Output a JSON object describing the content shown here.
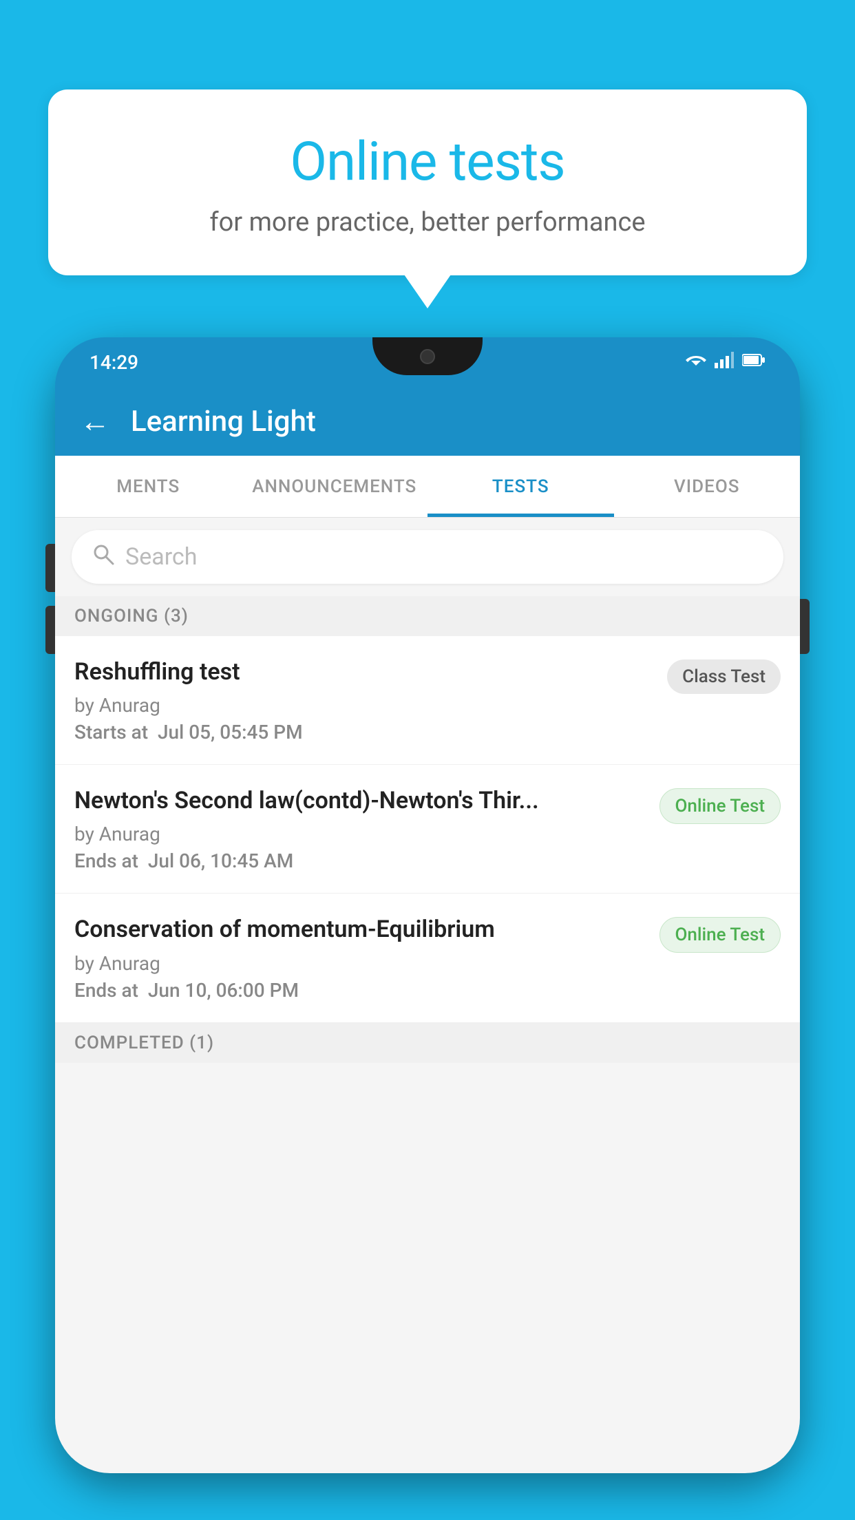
{
  "background_color": "#1ab8e8",
  "speech_bubble": {
    "title": "Online tests",
    "subtitle": "for more practice, better performance"
  },
  "phone": {
    "status_bar": {
      "time": "14:29",
      "icons": [
        "wifi",
        "signal",
        "battery"
      ]
    },
    "header": {
      "title": "Learning Light",
      "back_label": "←"
    },
    "tabs": [
      {
        "label": "MENTS",
        "active": false
      },
      {
        "label": "ANNOUNCEMENTS",
        "active": false
      },
      {
        "label": "TESTS",
        "active": true
      },
      {
        "label": "VIDEOS",
        "active": false
      }
    ],
    "search": {
      "placeholder": "Search"
    },
    "section_ongoing": {
      "label": "ONGOING (3)"
    },
    "tests": [
      {
        "name": "Reshuffling test",
        "author": "by Anurag",
        "time_label": "Starts at",
        "time_value": "Jul 05, 05:45 PM",
        "badge": "Class Test",
        "badge_type": "class"
      },
      {
        "name": "Newton's Second law(contd)-Newton's Thir...",
        "author": "by Anurag",
        "time_label": "Ends at",
        "time_value": "Jul 06, 10:45 AM",
        "badge": "Online Test",
        "badge_type": "online"
      },
      {
        "name": "Conservation of momentum-Equilibrium",
        "author": "by Anurag",
        "time_label": "Ends at",
        "time_value": "Jun 10, 06:00 PM",
        "badge": "Online Test",
        "badge_type": "online"
      }
    ],
    "section_completed": {
      "label": "COMPLETED (1)"
    }
  }
}
